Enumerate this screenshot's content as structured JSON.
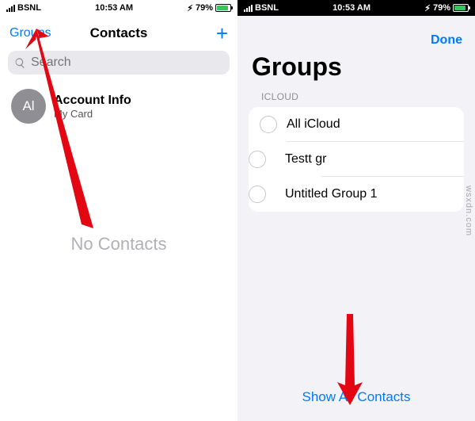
{
  "leftPane": {
    "status": {
      "carrier": "BSNL",
      "time": "10:53 AM",
      "battery": "79%"
    },
    "nav": {
      "groupsBtn": "Groups",
      "title": "Contacts"
    },
    "search": {
      "placeholder": "Search"
    },
    "contact": {
      "initials": "Al",
      "name": "Account Info",
      "sub": "My Card"
    },
    "empty": "No Contacts"
  },
  "rightPane": {
    "status": {
      "carrier": "BSNL",
      "time": "10:53 AM",
      "battery": "79%"
    },
    "doneBtn": "Done",
    "title": "Groups",
    "sectionLabel": "ICLOUD",
    "items": [
      {
        "label": "All iCloud"
      },
      {
        "label": "Testt gr"
      },
      {
        "label": "Untitled Group 1"
      }
    ],
    "showAll": "Show All Contacts"
  },
  "watermark": "wsxdn.com"
}
